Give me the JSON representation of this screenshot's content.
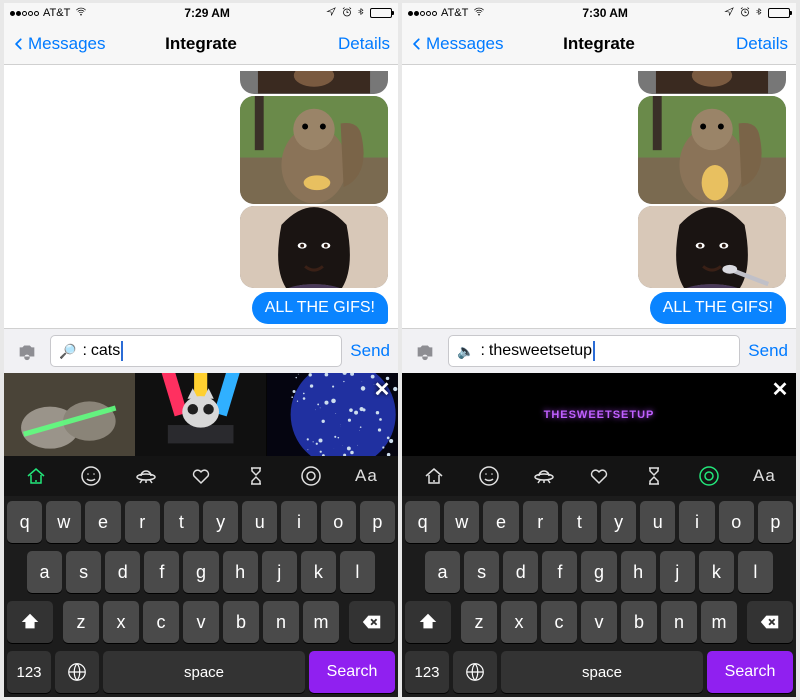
{
  "screens": [
    {
      "status": {
        "carrier": "AT&T",
        "time": "7:29 AM"
      },
      "nav": {
        "back": "Messages",
        "title": "Integrate",
        "right": "Details"
      },
      "bubble_text": "ALL THE GIFS!",
      "input": {
        "emoji": "🔎",
        "text": "cats"
      },
      "send": "Send",
      "gif_mode": "results",
      "gif_overlay_text": "",
      "active_cat": 0
    },
    {
      "status": {
        "carrier": "AT&T",
        "time": "7:30 AM"
      },
      "nav": {
        "back": "Messages",
        "title": "Integrate",
        "right": "Details"
      },
      "bubble_text": "ALL THE GIFS!",
      "input": {
        "emoji": "🔈",
        "text": "thesweetsetup"
      },
      "send": "Send",
      "gif_mode": "single",
      "gif_overlay_text": "THESWEETSETUP",
      "active_cat": 5
    }
  ],
  "categories_count": 7,
  "keys": {
    "row1": [
      "q",
      "w",
      "e",
      "r",
      "t",
      "y",
      "u",
      "i",
      "o",
      "p"
    ],
    "row2": [
      "a",
      "s",
      "d",
      "f",
      "g",
      "h",
      "j",
      "k",
      "l"
    ],
    "row3": [
      "z",
      "x",
      "c",
      "v",
      "b",
      "n",
      "m"
    ],
    "num": "123",
    "space": "space",
    "search": "Search"
  },
  "aa_label": "Aa"
}
